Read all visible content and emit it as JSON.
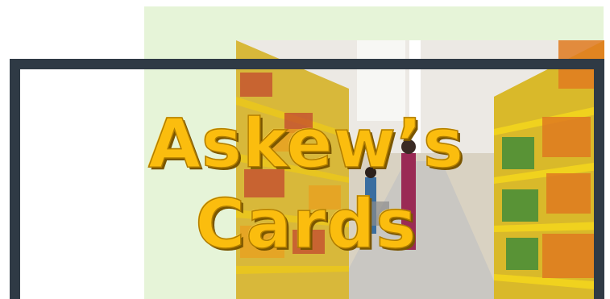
{
  "banner": {
    "title_line1": "Askew’s",
    "title_line2": "Cards"
  },
  "colors": {
    "frame": "#2f3a45",
    "panel": "#e6f4d8",
    "title": "#fbbd0e"
  },
  "icons": {
    "photo": "supermarket-aisle-image"
  }
}
